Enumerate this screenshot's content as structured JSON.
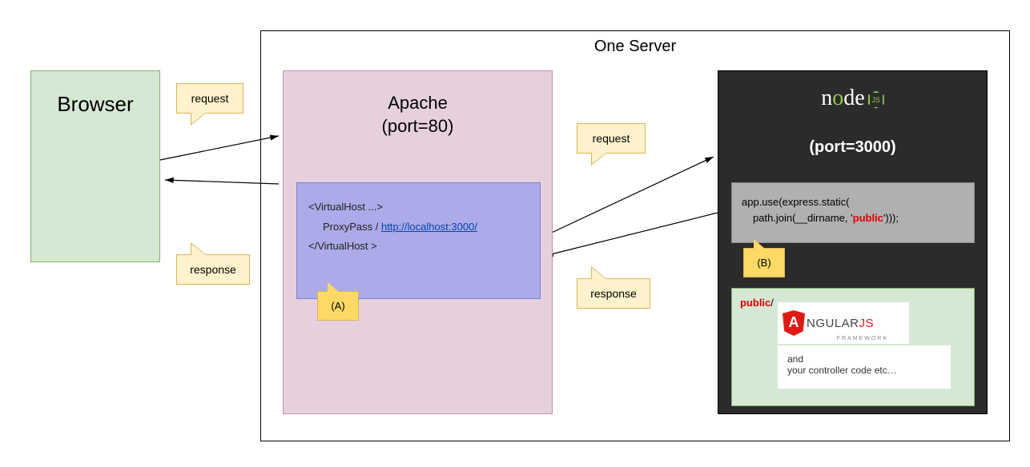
{
  "browser": {
    "title": "Browser"
  },
  "server": {
    "title": "One Server"
  },
  "apache": {
    "title_line1": "Apache",
    "title_line2": "(port=80)",
    "vhost": {
      "open": "<VirtualHost ...>",
      "proxy_label": "ProxyPass / ",
      "proxy_url": "http://localhost:3000/",
      "close": "</VirtualHost >"
    }
  },
  "node": {
    "logo_n": "n",
    "logo_o1": "o",
    "logo_d": "d",
    "logo_e": "e",
    "logo_js": "JS",
    "port": "(port=3000)",
    "express": {
      "line1": "app.use(express.static(",
      "line2_pre": "path.join(__dirname, '",
      "line2_red": "public",
      "line2_post": "')));"
    },
    "public": {
      "label_red": "public",
      "label_slash": "/",
      "angular_a": "A",
      "angular_text1": "NGULAR",
      "angular_text2": "JS",
      "angular_sub": "FRAMEWORK",
      "note_line1": "and",
      "note_line2": "your controller code etc…"
    }
  },
  "callouts": {
    "request1": "request",
    "response1": "response",
    "request2": "request",
    "response2": "response",
    "a": "(A)",
    "b": "(B)"
  }
}
